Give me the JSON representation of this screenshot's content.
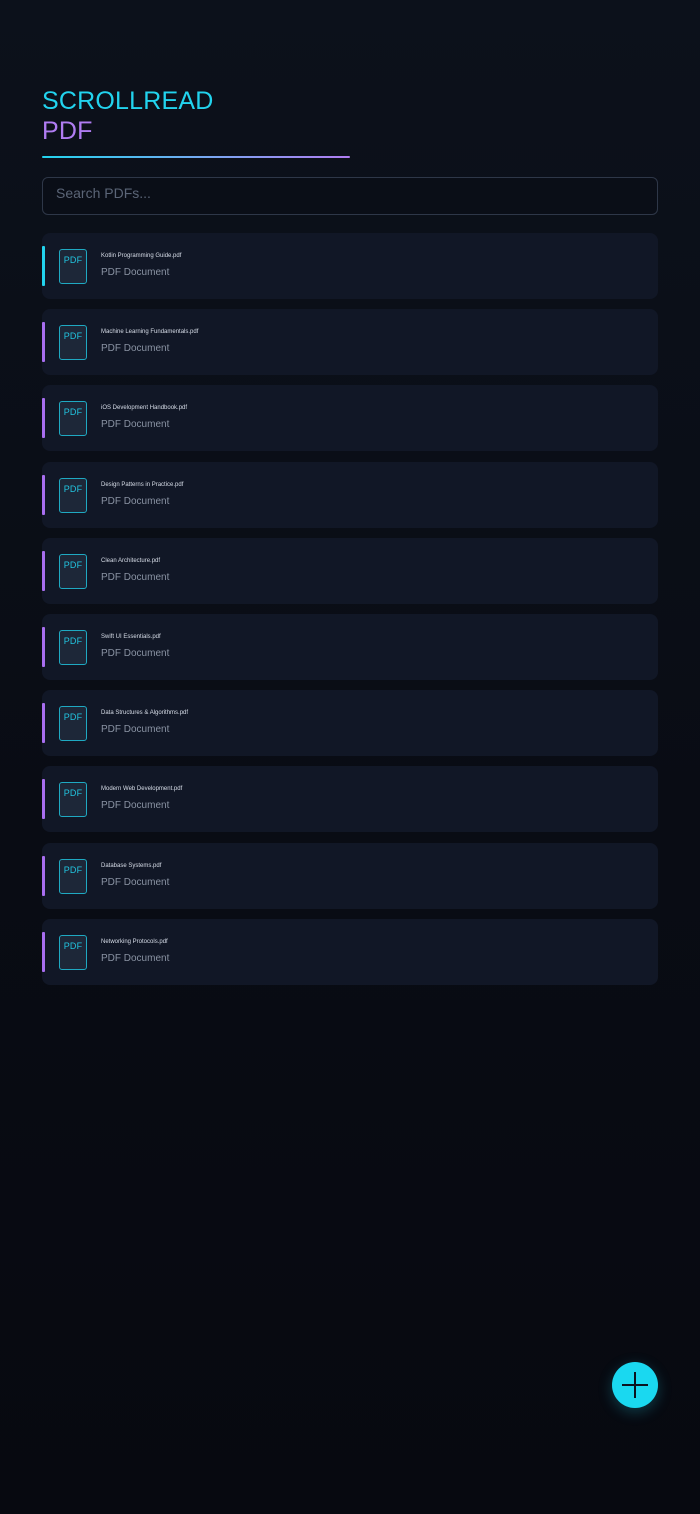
{
  "app": {
    "title_line1": "SCROLLREAD",
    "title_line2": "PDF"
  },
  "search": {
    "placeholder": "Search PDFs...",
    "value": ""
  },
  "files": [
    {
      "name": "Kotlin Programming Guide.pdf",
      "type": "PDF Document",
      "icon_label": "PDF",
      "active": true
    },
    {
      "name": "Machine Learning Fundamentals.pdf",
      "type": "PDF Document",
      "icon_label": "PDF",
      "active": false
    },
    {
      "name": "iOS Development Handbook.pdf",
      "type": "PDF Document",
      "icon_label": "PDF",
      "active": false
    },
    {
      "name": "Design Patterns in Practice.pdf",
      "type": "PDF Document",
      "icon_label": "PDF",
      "active": false
    },
    {
      "name": "Clean Architecture.pdf",
      "type": "PDF Document",
      "icon_label": "PDF",
      "active": false
    },
    {
      "name": "Swift UI Essentials.pdf",
      "type": "PDF Document",
      "icon_label": "PDF",
      "active": false
    },
    {
      "name": "Data Structures & Algorithms.pdf",
      "type": "PDF Document",
      "icon_label": "PDF",
      "active": false
    },
    {
      "name": "Modern Web Development.pdf",
      "type": "PDF Document",
      "icon_label": "PDF",
      "active": false
    },
    {
      "name": "Database Systems.pdf",
      "type": "PDF Document",
      "icon_label": "PDF",
      "active": false
    },
    {
      "name": "Networking Protocols.pdf",
      "type": "PDF Document",
      "icon_label": "PDF",
      "active": false
    }
  ],
  "fab": {
    "icon": "plus-icon"
  },
  "colors": {
    "background": "#090c14",
    "accent_cyan": "#22d3ee",
    "accent_purple": "#b07cf2",
    "card_background": "#111726"
  }
}
